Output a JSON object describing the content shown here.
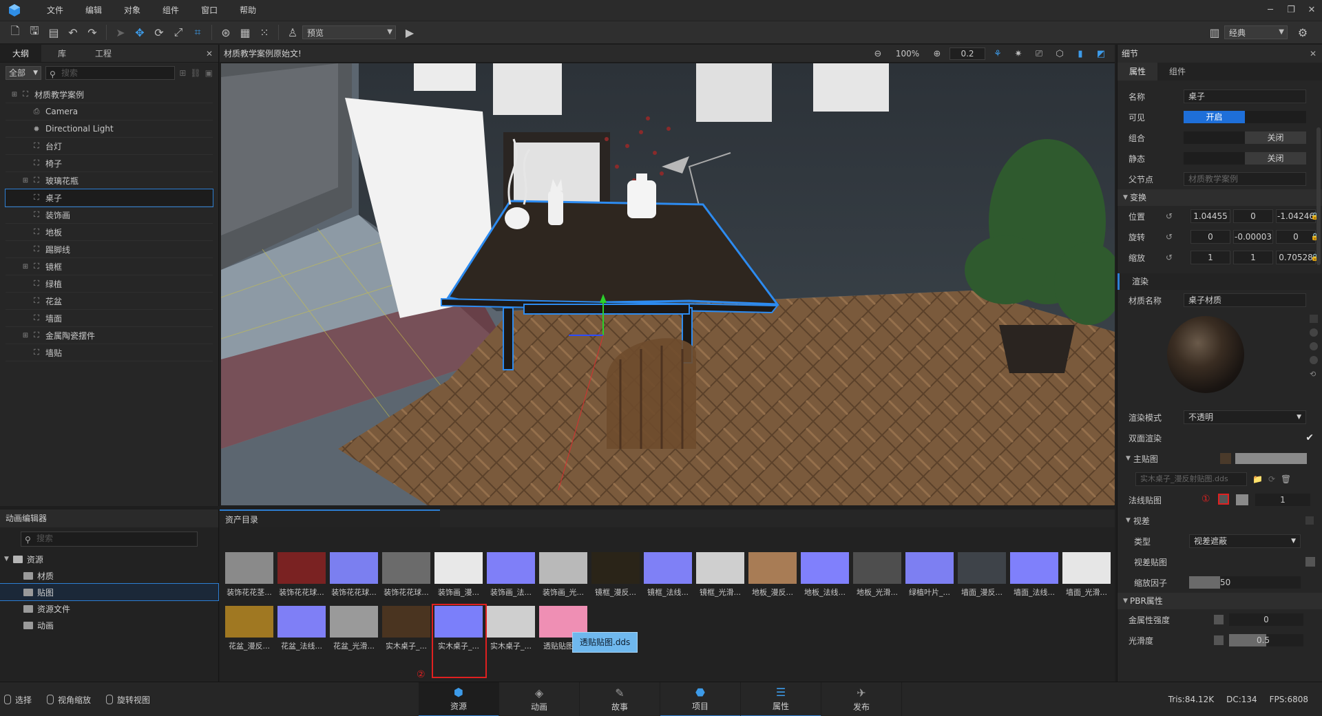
{
  "menubar": {
    "items": [
      "文件",
      "编辑",
      "对象",
      "组件",
      "窗口",
      "帮助"
    ]
  },
  "toolbar": {
    "preview_select": "预览",
    "layout_select": "经典"
  },
  "outline": {
    "tabs": [
      "大纲",
      "库",
      "工程"
    ],
    "filter": "全部",
    "search_placeholder": "搜索",
    "items": [
      {
        "label": "材质教学案例",
        "icon": "group-icon"
      },
      {
        "label": "Camera",
        "icon": "camera-icon"
      },
      {
        "label": "Directional Light",
        "icon": "light-icon"
      },
      {
        "label": "台灯",
        "icon": "object-icon"
      },
      {
        "label": "椅子",
        "icon": "object-icon"
      },
      {
        "label": "玻璃花瓶",
        "icon": "object-icon"
      },
      {
        "label": "桌子",
        "icon": "object-icon"
      },
      {
        "label": "装饰画",
        "icon": "object-icon"
      },
      {
        "label": "地板",
        "icon": "object-icon"
      },
      {
        "label": "踢脚线",
        "icon": "object-icon"
      },
      {
        "label": "镜框",
        "icon": "object-icon"
      },
      {
        "label": "绿植",
        "icon": "object-icon"
      },
      {
        "label": "花盆",
        "icon": "object-icon"
      },
      {
        "label": "墙面",
        "icon": "object-icon"
      },
      {
        "label": "金属陶瓷摆件",
        "icon": "object-icon"
      },
      {
        "label": "墙贴",
        "icon": "object-icon"
      }
    ]
  },
  "viewport": {
    "title": "材质教学案例原始文!",
    "zoom": "100%",
    "step": "0.2"
  },
  "details": {
    "title": "细节",
    "tabs": [
      "属性",
      "组件"
    ],
    "name_label": "名称",
    "name_value": "桌子",
    "visible_label": "可见",
    "visible_on": "开启",
    "group_label": "组合",
    "group_off": "关闭",
    "static_label": "静态",
    "static_off": "关闭",
    "parent_label": "父节点",
    "parent_value": "材质教学案例",
    "transform_section": "变换",
    "position_label": "位置",
    "position": [
      "1.04455",
      "0",
      "-1.04246"
    ],
    "rotation_label": "旋转",
    "rotation": [
      "0",
      "-0.00003",
      "0"
    ],
    "scale_label": "缩放",
    "scale": [
      "1",
      "1",
      "0.70528"
    ],
    "render_section": "渲染",
    "material_name_label": "材质名称",
    "material_name": "桌子材质",
    "render_mode_label": "渲染模式",
    "render_mode": "不透明",
    "double_side_label": "双面渲染",
    "main_tex_label": "主贴图",
    "main_tex_file": "实木桌子_漫反射贴图.dds",
    "normal_tex_label": "法线贴图",
    "normal_value": "1",
    "parallax_label": "视差",
    "type_label": "类型",
    "type_value": "视差遮蔽",
    "parallax_tex_label": "视差贴图",
    "scale_factor_label": "缩放因子",
    "scale_factor": "50",
    "pbr_section": "PBR属性",
    "metal_label": "金属性强度",
    "metal_value": "0",
    "smooth_label": "光滑度",
    "smooth_value": "0.5",
    "marker1": "①",
    "marker2": "②"
  },
  "anim_editor": {
    "title": "动画编辑器",
    "search_placeholder": "搜索",
    "tree": [
      {
        "label": "资源",
        "indent": 0,
        "selected": false
      },
      {
        "label": "材质",
        "indent": 1,
        "selected": false
      },
      {
        "label": "贴图",
        "indent": 1,
        "selected": true
      },
      {
        "label": "资源文件",
        "indent": 1,
        "selected": false
      },
      {
        "label": "动画",
        "indent": 1,
        "selected": false
      }
    ]
  },
  "assets": {
    "title": "资产目录",
    "tooltip": "透贴贴图.dds",
    "row1": [
      {
        "label": "装饰花花茎...",
        "color": "#8a8a8a"
      },
      {
        "label": "装饰花花球...",
        "color": "#7a2222"
      },
      {
        "label": "装饰花花球...",
        "color": "#7b7ff0"
      },
      {
        "label": "装饰花花球...",
        "color": "#6b6b6b"
      },
      {
        "label": "装饰画_漫...",
        "color": "#e8e8e8"
      },
      {
        "label": "装饰画_法...",
        "color": "#7f7ff8"
      },
      {
        "label": "装饰画_光...",
        "color": "#b9b9b9"
      },
      {
        "label": "镜框_漫反...",
        "color": "#2a2418"
      },
      {
        "label": "镜框_法线...",
        "color": "#7f80f6"
      },
      {
        "label": "镜框_光滑...",
        "color": "#cfcfcf"
      },
      {
        "label": "地板_漫反...",
        "color": "#a87c55"
      },
      {
        "label": "地板_法线...",
        "color": "#8080fc"
      },
      {
        "label": "地板_光滑...",
        "color": "#4e4e4e"
      },
      {
        "label": "绿植叶片_...",
        "color": "#7d7ff2"
      },
      {
        "label": "墙面_漫反...",
        "color": "#3e4349"
      },
      {
        "label": "墙面_法线...",
        "color": "#7f80fb"
      },
      {
        "label": "墙面_光滑...",
        "color": "#e6e6e6"
      }
    ],
    "row2": [
      {
        "label": "花盆_漫反...",
        "color": "#a07822"
      },
      {
        "label": "花盆_法线...",
        "color": "#7f7ff6"
      },
      {
        "label": "花盆_光滑...",
        "color": "#9a9a9a"
      },
      {
        "label": "实木桌子_...",
        "color": "#4a3420"
      },
      {
        "label": "实木桌子_...",
        "color": "#7b7ffa"
      },
      {
        "label": "实木桌子_...",
        "color": "#cfcfcf"
      },
      {
        "label": "透贴贴图....",
        "color": "#ef8fb4"
      }
    ]
  },
  "statusbar": {
    "left": [
      "选择",
      "视角缩放",
      "旋转视图"
    ],
    "tabs": [
      "资源",
      "动画",
      "故事",
      "项目",
      "属性",
      "发布"
    ],
    "tris": "Tris:84.12K",
    "dc": "DC:134",
    "fps": "FPS:6808"
  }
}
